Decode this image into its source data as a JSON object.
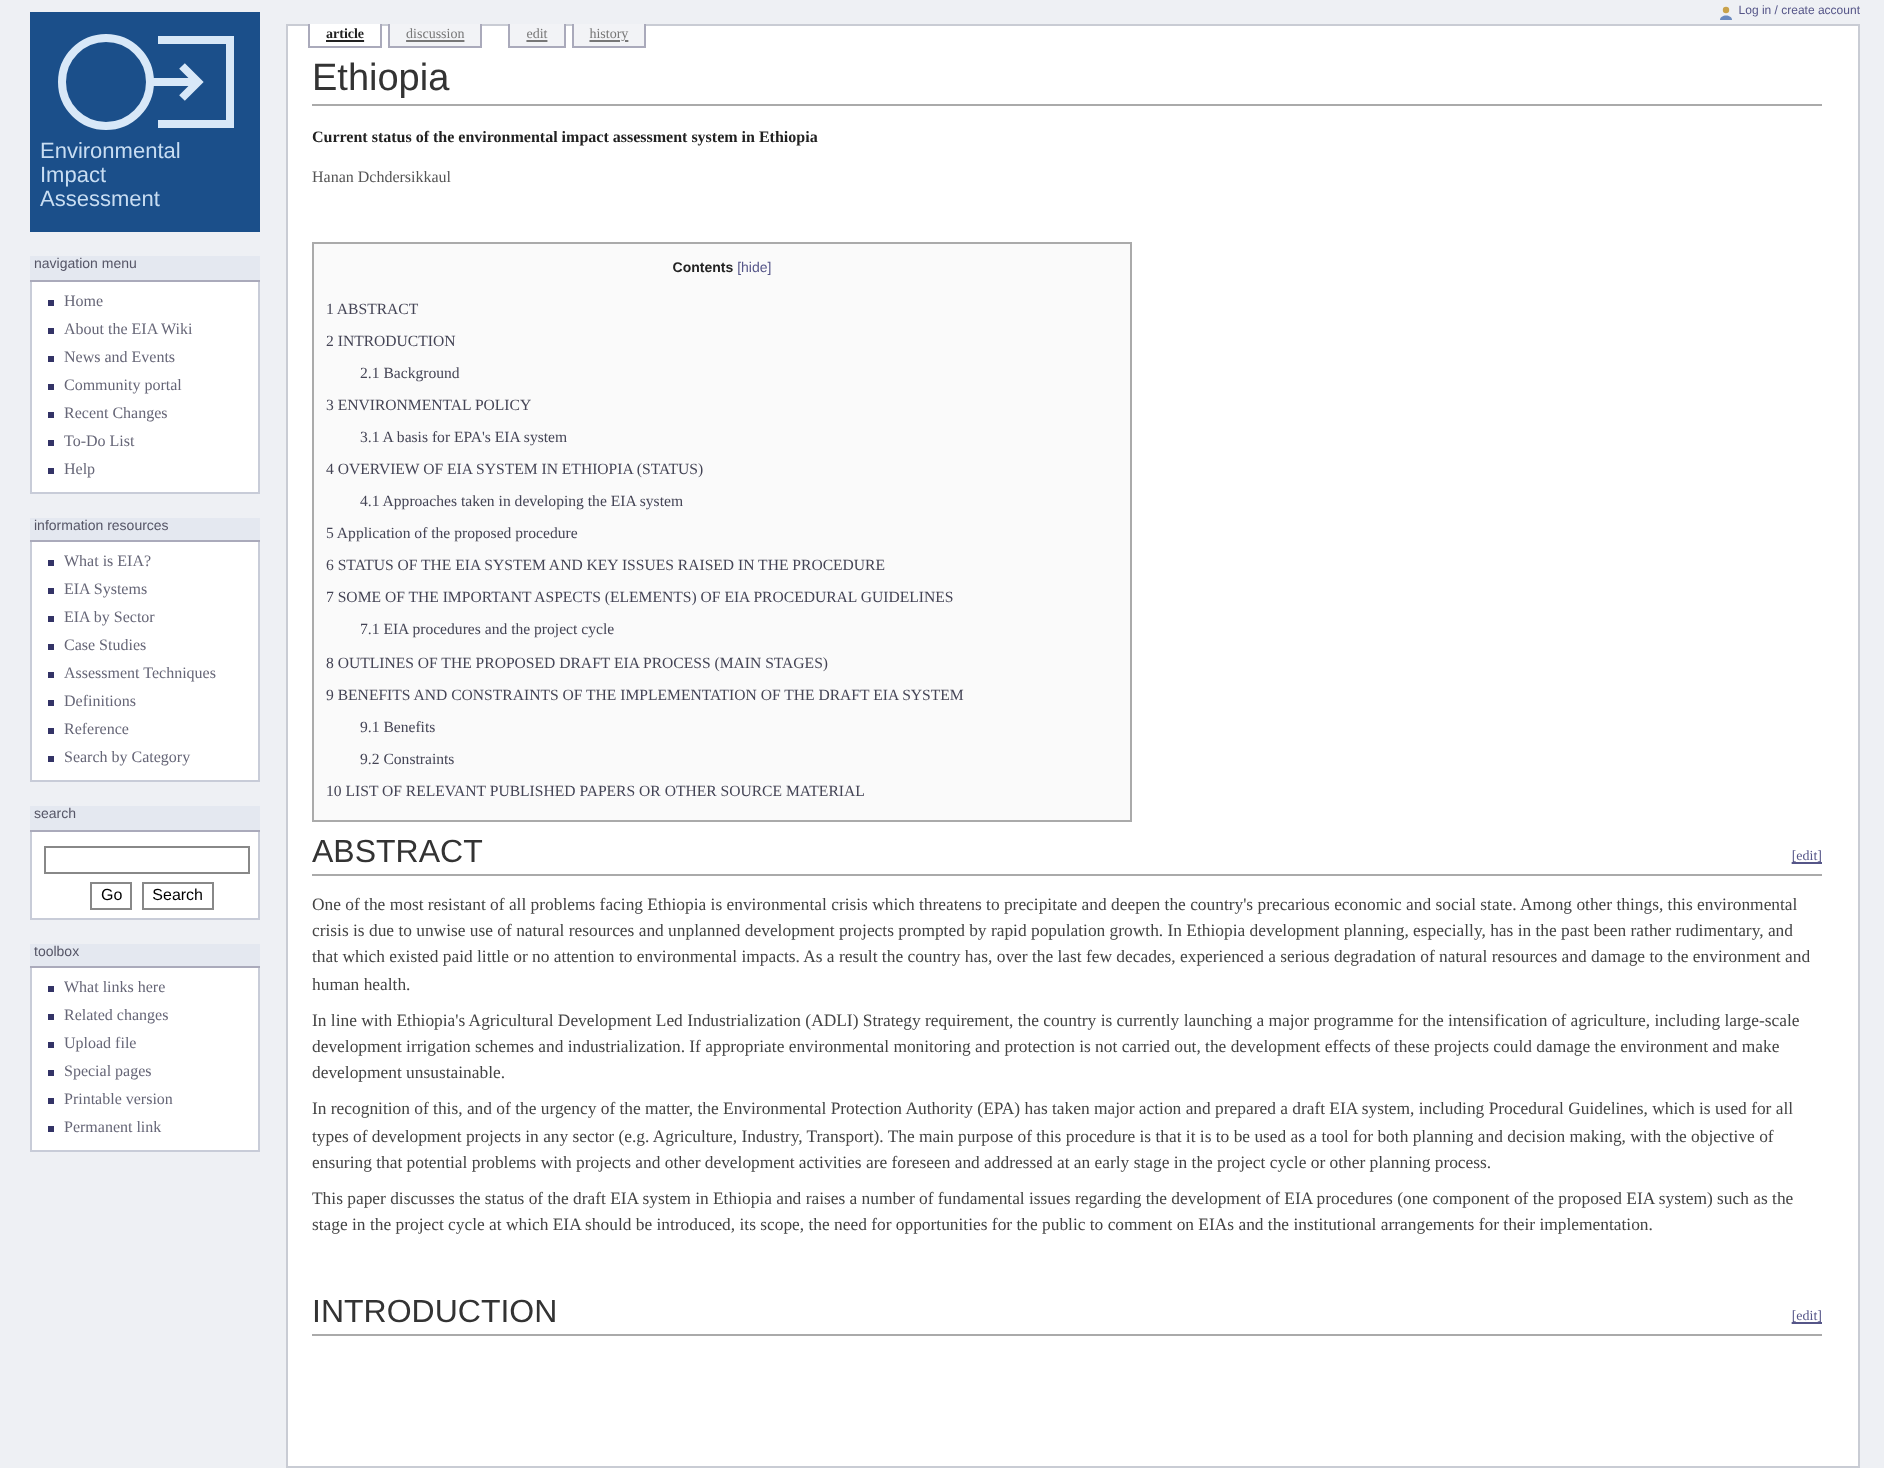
{
  "personal_tools": {
    "login": "Log in / create account"
  },
  "logo": {
    "lines": [
      "Environmental",
      "Impact",
      "Assessment"
    ]
  },
  "tabs": [
    {
      "label": "article",
      "selected": true
    },
    {
      "label": "discussion",
      "selected": false
    },
    {
      "label": "edit",
      "selected": false
    },
    {
      "label": "history",
      "selected": false
    }
  ],
  "sidebar": [
    {
      "kind": "links",
      "heading": "navigation menu",
      "items": [
        "Home",
        "About the EIA Wiki",
        "News and Events",
        "Community portal",
        "Recent Changes",
        "To-Do List",
        "Help"
      ]
    },
    {
      "kind": "links",
      "heading": "information resources",
      "items": [
        "What is EIA?",
        "EIA Systems",
        "EIA by Sector",
        "Case Studies",
        "Assessment Techniques",
        "Definitions",
        "Reference",
        "Search by Category"
      ]
    },
    {
      "kind": "search",
      "heading": "search",
      "buttons": [
        "Go",
        "Search"
      ]
    },
    {
      "kind": "links",
      "heading": "toolbox",
      "items": [
        "What links here",
        "Related changes",
        "Upload file",
        "Special pages",
        "Printable version",
        "Permanent link"
      ]
    }
  ],
  "page": {
    "title": "Ethiopia",
    "subtitle": "Current status of the environmental impact assessment system in Ethiopia",
    "author": "Hanan Dchdersikkaul"
  },
  "toc": {
    "title": "Contents",
    "toggle": "[hide]",
    "items": [
      {
        "number": "1",
        "text": "ABSTRACT"
      },
      {
        "number": "2",
        "text": "INTRODUCTION",
        "children": [
          {
            "number": "2.1",
            "text": "Background"
          }
        ]
      },
      {
        "number": "3",
        "text": "ENVIRONMENTAL POLICY",
        "children": [
          {
            "number": "3.1",
            "text": "A basis for EPA's EIA system"
          }
        ]
      },
      {
        "number": "4",
        "text": "OVERVIEW OF EIA SYSTEM IN ETHIOPIA (STATUS)",
        "children": [
          {
            "number": "4.1",
            "text": "Approaches taken in developing the EIA system"
          }
        ]
      },
      {
        "number": "5",
        "text": "Application of the proposed procedure"
      },
      {
        "number": "6",
        "text": "STATUS OF THE EIA SYSTEM AND KEY ISSUES RAISED IN THE PROCEDURE"
      },
      {
        "number": "7",
        "text": "SOME OF THE IMPORTANT ASPECTS (ELEMENTS) OF EIA PROCEDURAL GUIDELINES",
        "children": [
          {
            "number": "7.1",
            "text": "EIA procedures and the project cycle"
          }
        ]
      },
      {
        "number": "8",
        "text": "OUTLINES OF THE PROPOSED DRAFT EIA PROCESS (MAIN STAGES)"
      },
      {
        "number": "9",
        "text": "BENEFITS AND CONSTRAINTS OF THE IMPLEMENTATION OF THE DRAFT EIA SYSTEM",
        "children": [
          {
            "number": "9.1",
            "text": "Benefits"
          },
          {
            "number": "9.2",
            "text": "Constraints"
          }
        ]
      },
      {
        "number": "10",
        "text": "LIST OF RELEVANT PUBLISHED PAPERS OR OTHER SOURCE MATERIAL"
      }
    ]
  },
  "sections": [
    {
      "heading": "ABSTRACT",
      "edit": "[edit]",
      "paragraphs": [
        "One of the most resistant of all problems facing Ethiopia is environmental crisis which threatens to precipitate and deepen the country's precarious economic and social state. Among other things, this environmental crisis is due to unwise use of natural resources and unplanned development projects prompted by rapid population growth. In Ethiopia development planning, especially, has in the past been rather rudimentary, and that which existed paid little or no attention to environmental impacts. As a result the country has, over the last few decades, experienced a serious degradation of natural resources and damage to the environment and human health.",
        "In line with Ethiopia's Agricultural Development Led Industrialization (ADLI) Strategy requirement, the country is currently launching a major programme for the intensification of agriculture, including large-scale development irrigation schemes and industrialization. If appropriate environmental monitoring and protection is not carried out, the development effects of these projects could damage the environment and make development unsustainable.",
        "In recognition of this, and of the urgency of the matter, the Environmental Protection Authority (EPA) has taken major action and prepared a draft EIA system, including Procedural Guidelines, which is used for all types of development projects in any sector (e.g. Agriculture, Industry, Transport). The main purpose of this procedure is that it is to be used as a tool for both planning and decision making, with the objective of ensuring that potential problems with projects and other development activities are foreseen and addressed at an early stage in the project cycle or other planning process.",
        "This paper discusses the status of the draft EIA system in Ethiopia and raises a number of fundamental issues regarding the development of EIA procedures (one component of the proposed EIA system) such as the stage in the project cycle at which EIA should be introduced, its scope, the need for opportunities for the public to comment on EIAs and the institutional arrangements for their implementation."
      ]
    },
    {
      "heading": "INTRODUCTION",
      "edit": "[edit]"
    }
  ]
}
